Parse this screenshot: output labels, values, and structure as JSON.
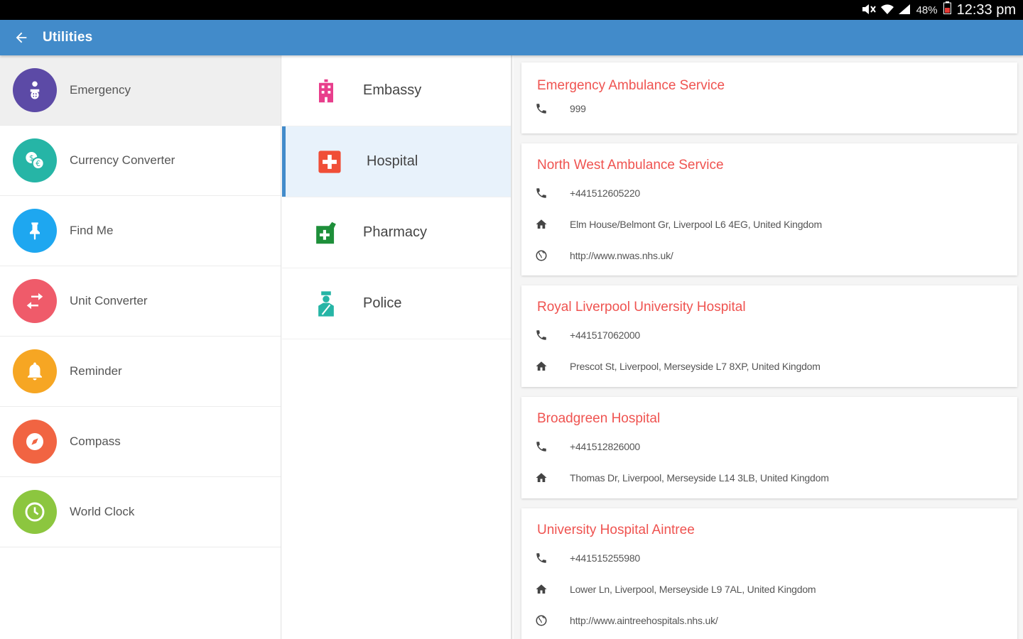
{
  "status": {
    "battery": "48%",
    "time": "12:33 pm"
  },
  "appbar": {
    "title": "Utilities"
  },
  "sidebar": {
    "items": [
      {
        "label": "Emergency",
        "color": "#5c4aa6",
        "icon": "emergency-icon"
      },
      {
        "label": "Currency Converter",
        "color": "#26b5a6",
        "icon": "currency-icon"
      },
      {
        "label": "Find Me",
        "color": "#1ea7f0",
        "icon": "pin-icon"
      },
      {
        "label": "Unit Converter",
        "color": "#ef5b6a",
        "icon": "swap-icon"
      },
      {
        "label": "Reminder",
        "color": "#f6a623",
        "icon": "bell-icon"
      },
      {
        "label": "Compass",
        "color": "#f16442",
        "icon": "compass-icon"
      },
      {
        "label": "World Clock",
        "color": "#8cc63f",
        "icon": "clock-icon"
      }
    ]
  },
  "categories": {
    "items": [
      {
        "label": "Embassy",
        "color": "#e83e8c",
        "icon": "building-icon"
      },
      {
        "label": "Hospital",
        "color": "#f04e37",
        "icon": "hospital-icon"
      },
      {
        "label": "Pharmacy",
        "color": "#1e8f3a",
        "icon": "pharmacy-icon"
      },
      {
        "label": "Police",
        "color": "#26b5a6",
        "icon": "police-icon"
      }
    ]
  },
  "cards": [
    {
      "title": "Emergency Ambulance Service",
      "phone": "999"
    },
    {
      "title": "North West Ambulance Service",
      "phone": "+441512605220",
      "address": "Elm House/Belmont Gr, Liverpool L6 4EG, United Kingdom",
      "website": "http://www.nwas.nhs.uk/"
    },
    {
      "title": "Royal Liverpool University Hospital",
      "phone": "+441517062000",
      "address": "Prescot St, Liverpool, Merseyside L7 8XP, United Kingdom"
    },
    {
      "title": "Broadgreen Hospital",
      "phone": "+441512826000",
      "address": "Thomas Dr, Liverpool, Merseyside L14 3LB, United Kingdom"
    },
    {
      "title": "University Hospital Aintree",
      "phone": "+441515255980",
      "address": "Lower Ln, Liverpool, Merseyside L9 7AL, United Kingdom",
      "website": "http://www.aintreehospitals.nhs.uk/"
    }
  ]
}
